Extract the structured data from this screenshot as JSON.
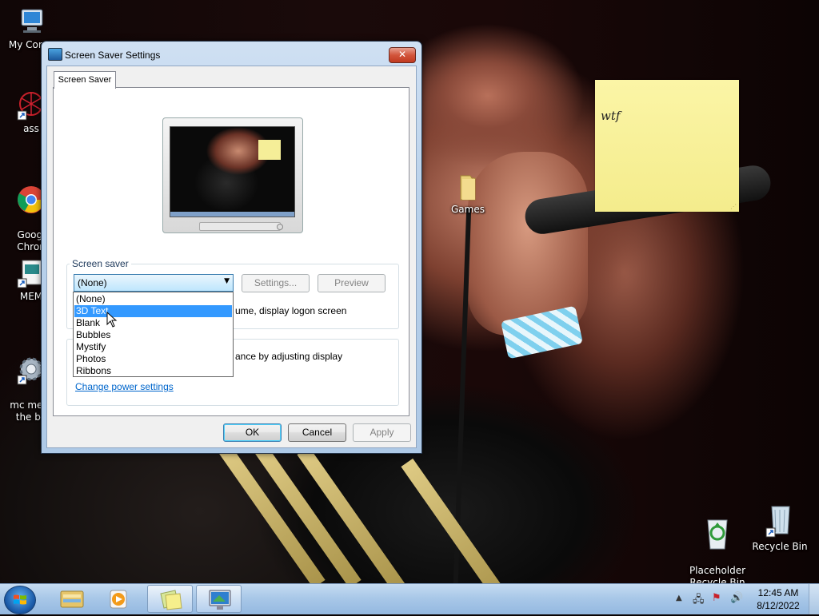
{
  "desktop": {
    "icons": [
      {
        "label": "My Comp",
        "icon": "computer-icon"
      },
      {
        "label": "ass",
        "icon": "shortcut-red-icon"
      },
      {
        "label": "Googl\nChron",
        "icon": "chrome-icon"
      },
      {
        "label": "MEM",
        "icon": "document-shortcut-icon"
      },
      {
        "label": "mc ment\nthe be",
        "icon": "gear-icon"
      },
      {
        "label": "Games",
        "icon": "folder-icon"
      },
      {
        "label": "Placeholder\nRecycle Bin",
        "icon": "recycle-bin-full-icon"
      },
      {
        "label": "Recycle Bin",
        "icon": "recycle-bin-icon"
      }
    ],
    "sticky_note": {
      "text": "wtf"
    }
  },
  "dialog": {
    "title": "Screen Saver Settings",
    "close_label": "✕",
    "tab": "Screen Saver",
    "screen_saver_group": {
      "label": "Screen saver",
      "selected": "(None)",
      "settings_label": "Settings...",
      "preview_label": "Preview",
      "resume_text_visible": "ume, display logon screen"
    },
    "power_group": {
      "text_visible": "ance by adjusting display",
      "link": "Change power settings"
    },
    "dropdown_options": [
      "(None)",
      "3D Text",
      "Blank",
      "Bubbles",
      "Mystify",
      "Photos",
      "Ribbons"
    ],
    "highlighted_option": "3D Text",
    "ok_label": "OK",
    "cancel_label": "Cancel",
    "apply_label": "Apply"
  },
  "taskbar": {
    "time": "12:45 AM",
    "date": "8/12/2022",
    "pinned": [
      "windows-explorer-icon",
      "media-player-icon",
      "sticky-notes-icon",
      "screen-saver-settings-icon"
    ]
  },
  "colors": {
    "selection": "#3399ff",
    "link": "#0066cc",
    "sticky": "#f8f1a0"
  }
}
